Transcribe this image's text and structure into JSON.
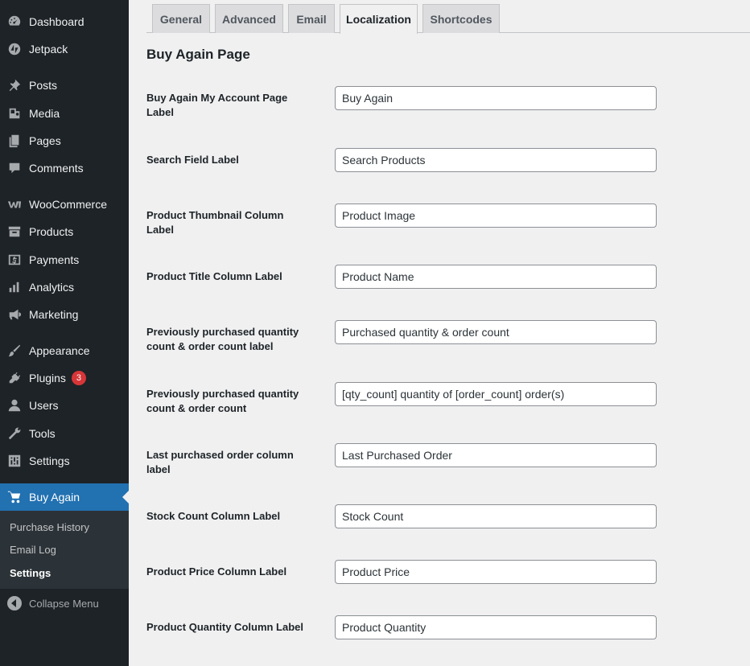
{
  "sidebar": {
    "items": [
      {
        "label": "Dashboard",
        "icon": "dashboard-icon"
      },
      {
        "label": "Jetpack",
        "icon": "jetpack-icon"
      },
      {
        "label": "Posts",
        "icon": "pin-icon"
      },
      {
        "label": "Media",
        "icon": "media-icon"
      },
      {
        "label": "Pages",
        "icon": "pages-icon"
      },
      {
        "label": "Comments",
        "icon": "comment-icon"
      },
      {
        "label": "WooCommerce",
        "icon": "woocommerce-icon"
      },
      {
        "label": "Products",
        "icon": "archive-icon"
      },
      {
        "label": "Payments",
        "icon": "payments-icon"
      },
      {
        "label": "Analytics",
        "icon": "bar-chart-icon"
      },
      {
        "label": "Marketing",
        "icon": "megaphone-icon"
      },
      {
        "label": "Appearance",
        "icon": "paintbrush-icon"
      },
      {
        "label": "Plugins",
        "icon": "plugin-icon",
        "badge": "3"
      },
      {
        "label": "Users",
        "icon": "user-icon"
      },
      {
        "label": "Tools",
        "icon": "wrench-icon"
      },
      {
        "label": "Settings",
        "icon": "settings-sliders-icon"
      },
      {
        "label": "Buy Again",
        "icon": "cart-icon",
        "active": true
      }
    ],
    "submenu": [
      "Purchase History",
      "Email Log",
      "Settings"
    ],
    "collapse_label": "Collapse Menu"
  },
  "tabs": [
    "General",
    "Advanced",
    "Email",
    "Localization",
    "Shortcodes"
  ],
  "active_tab": "Localization",
  "section_title": "Buy Again Page",
  "fields": [
    {
      "label": "Buy Again My Account Page Label",
      "value": "Buy Again"
    },
    {
      "label": "Search Field Label",
      "value": "Search Products"
    },
    {
      "label": "Product Thumbnail Column Label",
      "value": "Product Image"
    },
    {
      "label": "Product Title Column Label",
      "value": "Product Name"
    },
    {
      "label": "Previously purchased quantity count & order count label",
      "value": "Purchased quantity & order count"
    },
    {
      "label": "Previously purchased quantity count & order count",
      "value": "[qty_count] quantity of [order_count] order(s)"
    },
    {
      "label": "Last purchased order column label",
      "value": "Last Purchased Order"
    },
    {
      "label": "Stock Count Column Label",
      "value": "Stock Count"
    },
    {
      "label": "Product Price Column Label",
      "value": "Product Price"
    },
    {
      "label": "Product Quantity Column Label",
      "value": "Product Quantity"
    }
  ],
  "colors": {
    "sidebar_bg": "#1d2327",
    "accent": "#2271b1",
    "badge": "#d63638"
  }
}
